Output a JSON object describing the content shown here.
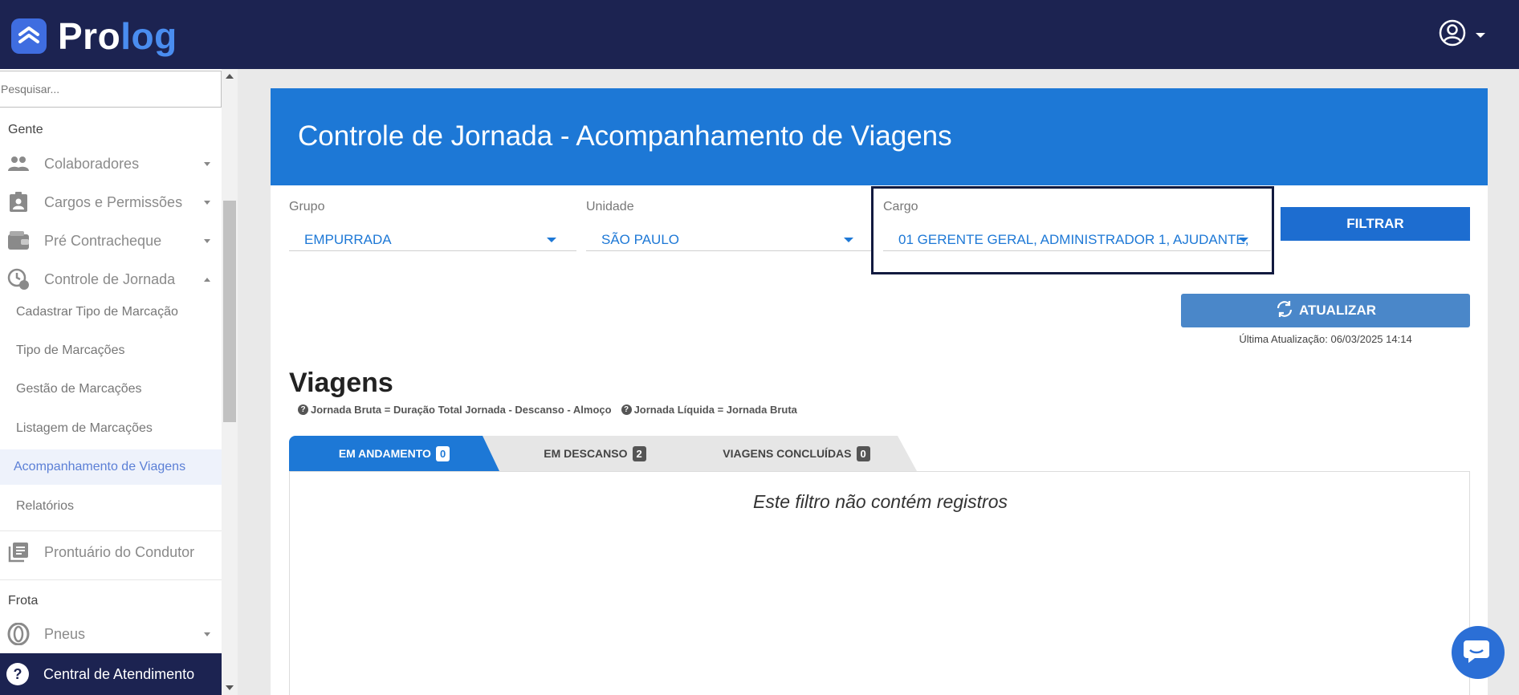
{
  "brand": {
    "pro": "Pro",
    "log": "log"
  },
  "sidebar": {
    "search_placeholder": "Pesquisar...",
    "section_gente": "Gente",
    "items": [
      {
        "label": "Colaboradores"
      },
      {
        "label": "Cargos e Permissões"
      },
      {
        "label": "Pré Contracheque"
      },
      {
        "label": "Controle de Jornada"
      }
    ],
    "sub_items": [
      {
        "label": "Cadastrar Tipo de Marcação"
      },
      {
        "label": "Tipo de Marcações"
      },
      {
        "label": "Gestão de Marcações"
      },
      {
        "label": "Listagem de Marcações"
      },
      {
        "label": "Acompanhamento de Viagens"
      },
      {
        "label": "Relatórios"
      }
    ],
    "prontuario": "Prontuário do Condutor",
    "section_frota": "Frota",
    "pneus": "Pneus",
    "central": "Central de Atendimento"
  },
  "main": {
    "title": "Controle de Jornada - Acompanhamento de Viagens",
    "filters": {
      "grupo_label": "Grupo",
      "grupo_value": "EMPURRADA",
      "unidade_label": "Unidade",
      "unidade_value": "SÃO PAULO",
      "cargo_label": "Cargo",
      "cargo_value": "01 GERENTE GERAL, ADMINISTRADOR 1, AJUDANTE,"
    },
    "filtrar_label": "FILTRAR",
    "atualizar_label": "ATUALIZAR",
    "last_update": "Última Atualização: 06/03/2025 14:14",
    "viagens_title": "Viagens",
    "legend_bruta": "Jornada Bruta = Duração Total Jornada - Descanso - Almoço",
    "legend_liquida": "Jornada Líquida = Jornada Bruta",
    "tabs": [
      {
        "label": "EM ANDAMENTO",
        "count": "0"
      },
      {
        "label": "EM DESCANSO",
        "count": "2"
      },
      {
        "label": "VIAGENS CONCLUÍDAS",
        "count": "0"
      }
    ],
    "empty_message": "Este filtro não contém registros"
  },
  "colors": {
    "topbar": "#1c2351",
    "header_blue": "#1d78d6",
    "button_blue": "#1d6dd0",
    "refresh_blue": "#4a87c9",
    "active_sub": "#5b7fd6"
  },
  "icons": [
    "prolog-logo-icon",
    "user-circle-icon",
    "people-icon",
    "badge-icon",
    "wallet-icon",
    "clock-icon",
    "book-icon",
    "tire-icon",
    "help-icon",
    "refresh-icon",
    "chat-icon"
  ]
}
